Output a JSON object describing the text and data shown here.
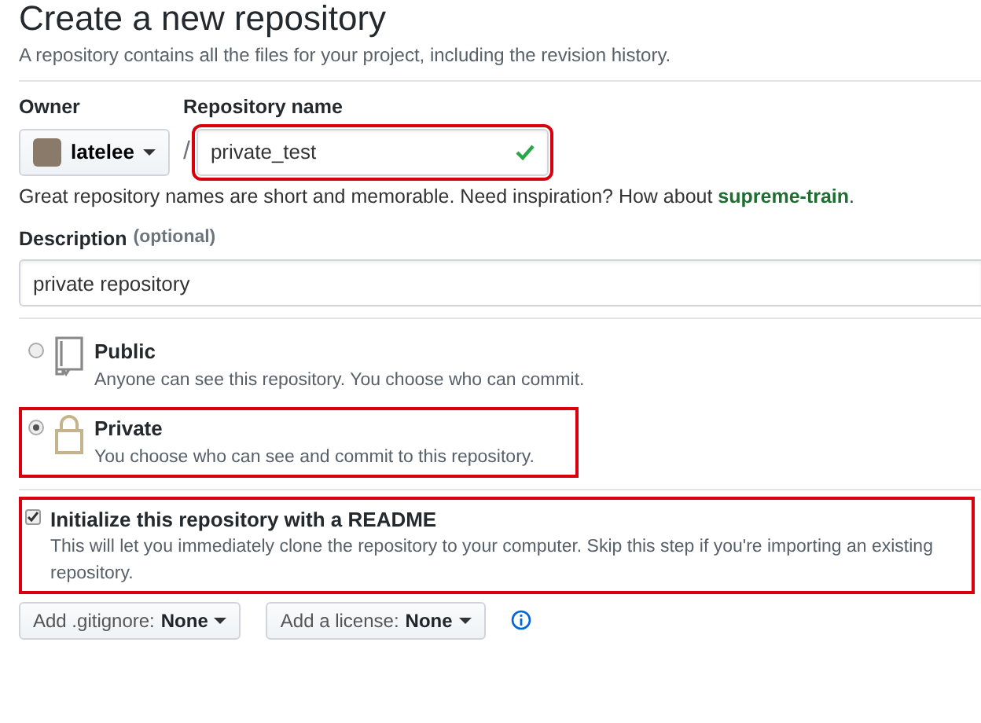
{
  "header": {
    "title": "Create a new repository",
    "subtitle": "A repository contains all the files for your project, including the revision history."
  },
  "owner": {
    "label": "Owner",
    "value": "latelee"
  },
  "repo_name": {
    "label": "Repository name",
    "separator": "/",
    "value": "private_test",
    "valid": true,
    "highlighted": true
  },
  "name_hint": "Great repository names are short and memorable. Need inspiration? How about **supreme-train**.",
  "description": {
    "label": "Description",
    "optional": "(optional)",
    "value": "private repository"
  },
  "visibility": [
    {
      "kind": "public",
      "title": "Public",
      "text": "Anyone can see this repository. You choose who can commit.",
      "selected": false,
      "highlighted": false
    },
    {
      "kind": "private",
      "title": "Private",
      "text": "You choose who can see and commit to this repository.",
      "selected": true,
      "highlighted": true
    }
  ],
  "readme": {
    "title": "Initialize this repository with a README",
    "text": "This will let you immediately clone the repository to your computer. Skip this step if you're importing an existing repository.",
    "checked": true,
    "highlighted": true
  },
  "dropdowns": [
    {
      "label": "Add .gitignore:",
      "value": "None"
    },
    {
      "label": "Add a license:",
      "value": "None"
    }
  ]
}
